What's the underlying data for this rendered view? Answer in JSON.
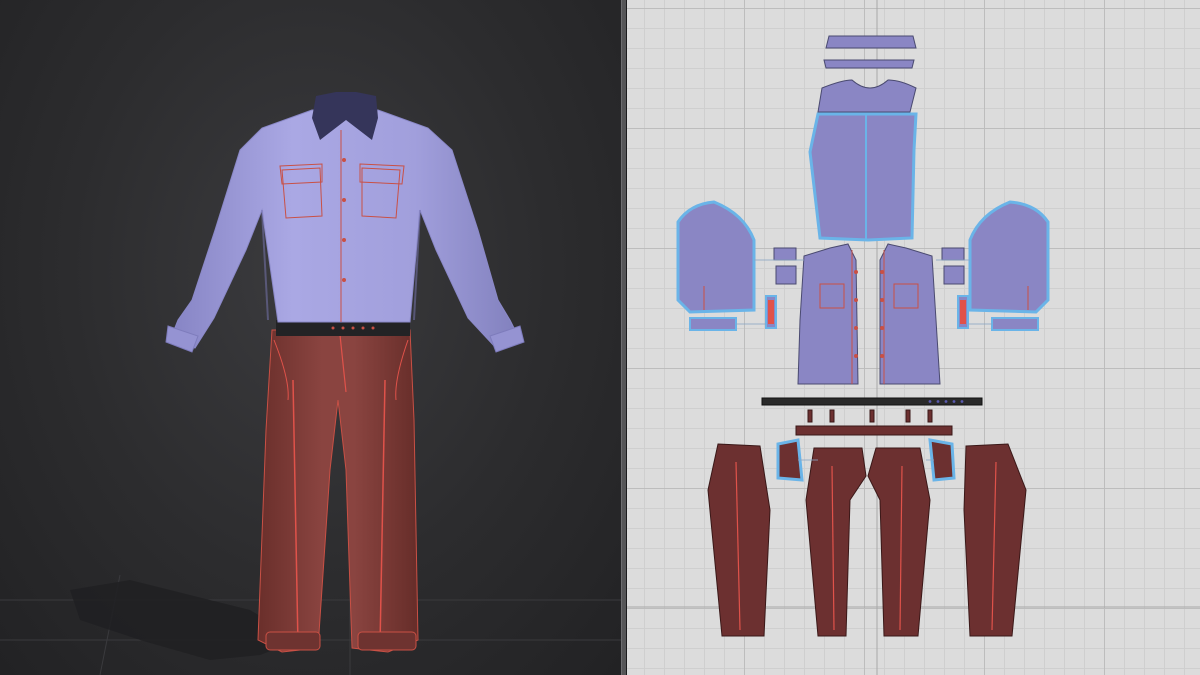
{
  "app": {
    "views": [
      "3d-garment-view",
      "2d-pattern-view"
    ]
  },
  "colors": {
    "viewport_3d_bg": "#2c2c2e",
    "viewport_2d_bg": "#dcdcdc",
    "shirt_fabric": "#9a98d6",
    "shirt_pattern_fill": "#8a86c4",
    "collar_fabric": "#3a3a5c",
    "pants_fabric": "#7a3a36",
    "pants_pattern_fill": "#6c3030",
    "belt": "#2a2a2a",
    "seam_line": "#e0524a",
    "selected_outline": "#6ab4e8"
  },
  "garment": {
    "items": [
      "shirt",
      "belt",
      "pants"
    ]
  }
}
